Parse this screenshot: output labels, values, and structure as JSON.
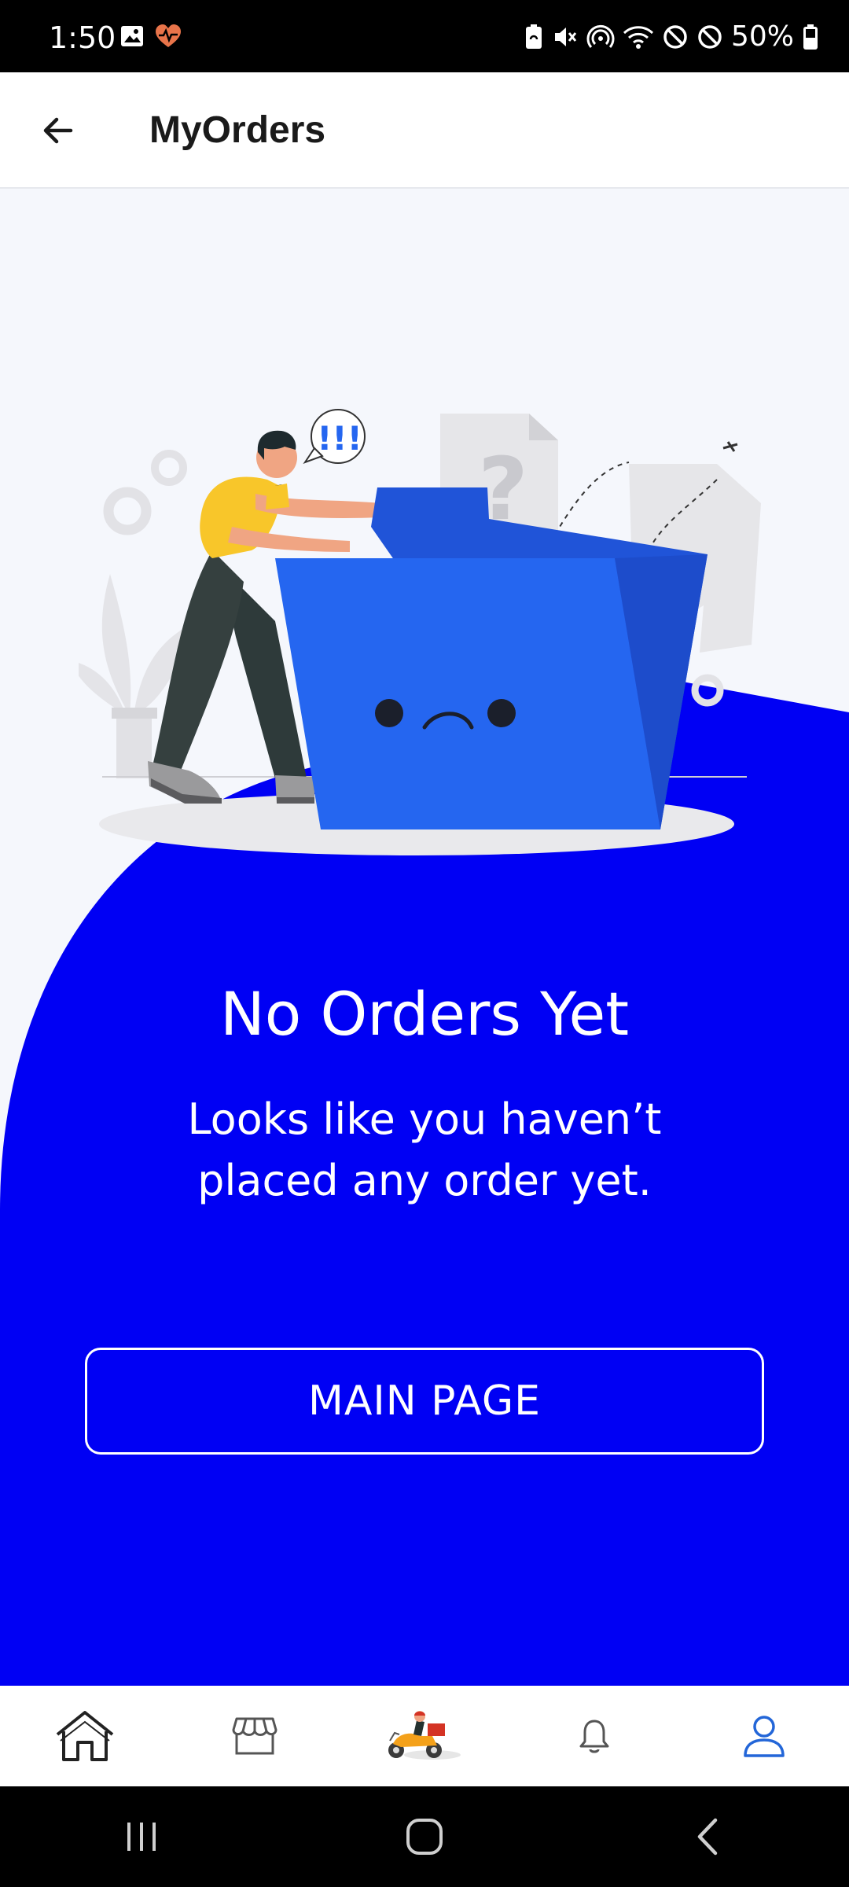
{
  "status_bar": {
    "time": "1:50",
    "battery": "50%",
    "left_icons": [
      "image-icon",
      "heart-pulse-icon"
    ],
    "right_icons": [
      "battery-saver-icon",
      "mute-icon",
      "hotspot-icon",
      "wifi-icon",
      "blocked-icon",
      "blocked-icon",
      "battery-icon"
    ]
  },
  "header": {
    "back_icon": "arrow-left-icon",
    "title": "MyOrders"
  },
  "empty_state": {
    "illustration": "empty-folder-illustration",
    "speech_bubble": "!!!",
    "doc_mark": "?",
    "title": "No Orders Yet",
    "description": "Looks like you haven’t placed any order yet.",
    "button_label": "MAIN PAGE"
  },
  "bottom_nav": {
    "items": [
      {
        "icon": "home-icon",
        "active": false
      },
      {
        "icon": "store-icon",
        "active": false
      },
      {
        "icon": "delivery-scooter-icon",
        "active": false
      },
      {
        "icon": "bell-icon",
        "active": false
      },
      {
        "icon": "user-icon",
        "active": true
      }
    ]
  },
  "system_nav": [
    "recents-icon",
    "home-button-icon",
    "back-icon"
  ],
  "colors": {
    "primary_blue": "#0000F4",
    "folder_blue": "#2566F0",
    "shirt_yellow": "#F8C62A",
    "page_bg": "#F5F7FC",
    "active_nav": "#2366D8"
  }
}
